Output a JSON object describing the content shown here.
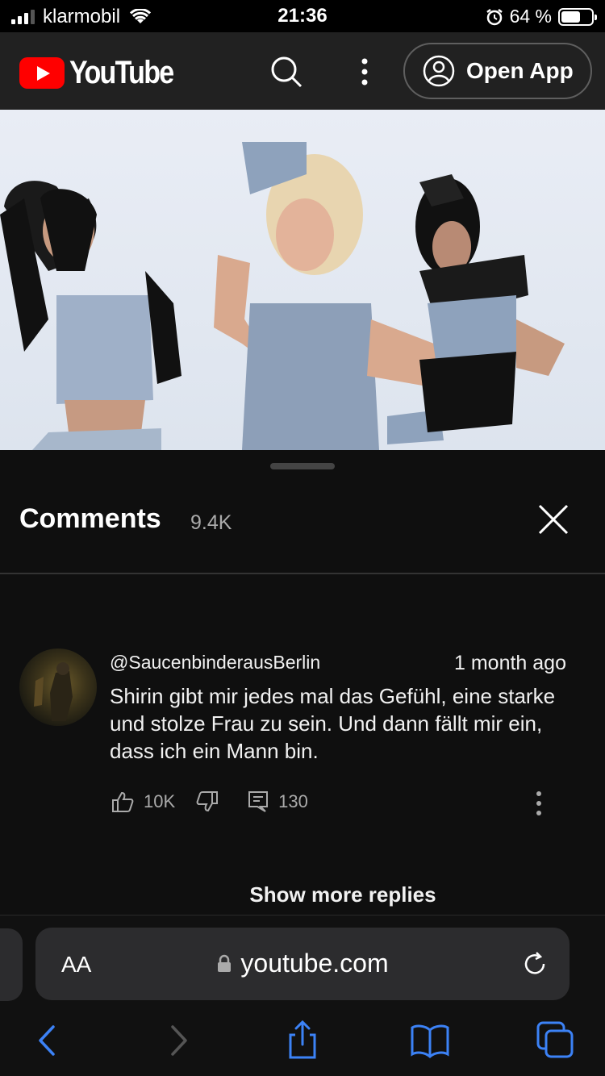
{
  "status_bar": {
    "carrier": "klarmobil",
    "time": "21:36",
    "battery_percent": "64 %",
    "battery_level": 0.64
  },
  "header": {
    "brand": "YouTube",
    "open_app_label": "Open App"
  },
  "video": {
    "description": "music video frame"
  },
  "comments": {
    "title": "Comments",
    "count": "9.4K",
    "items": [
      {
        "author": "@SaucenbinderausBerlin",
        "time": "1 month ago",
        "text": "Shirin gibt mir jedes mal das Gefühl, eine starke und stolze Frau zu sein. Und dann fällt mir ein, dass ich ein Mann bin.",
        "likes": "10K",
        "replies": "130"
      }
    ],
    "show_more": "Show more replies"
  },
  "browser": {
    "text_size_label": "AA",
    "url": "youtube.com"
  },
  "colors": {
    "brand_red": "#ff0000",
    "safari_blue": "#3c82f6",
    "sheet_bg": "#0f0f0f"
  }
}
